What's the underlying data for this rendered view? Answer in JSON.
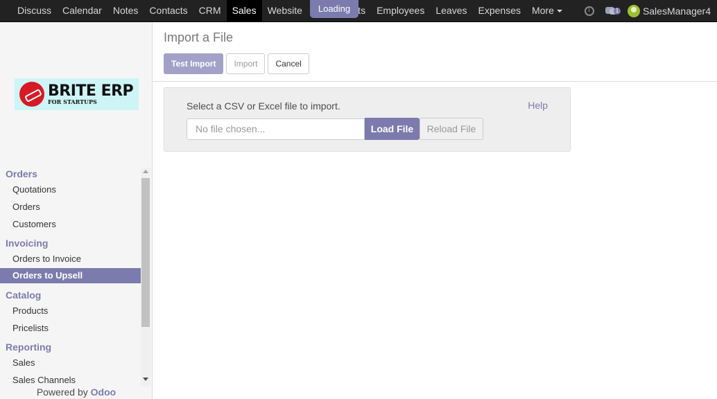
{
  "topnav": {
    "items": [
      "Discuss",
      "Calendar",
      "Notes",
      "Contacts",
      "CRM",
      "Sales",
      "Website",
      "Inv",
      "ents",
      "Employees",
      "Leaves",
      "Expenses",
      "More"
    ],
    "active": "Sales",
    "loading_label": "Loading",
    "chat_count": "1",
    "user_name": "SalesManager4"
  },
  "logo": {
    "title": "BRITE ERP",
    "subtitle": "FOR STARTUPS"
  },
  "sidebar": {
    "sections": [
      {
        "title": "Orders",
        "items": [
          "Quotations",
          "Orders",
          "Customers"
        ]
      },
      {
        "title": "Invoicing",
        "items": [
          "Orders to Invoice",
          "Orders to Upsell"
        ]
      },
      {
        "title": "Catalog",
        "items": [
          "Products",
          "Pricelists"
        ]
      },
      {
        "title": "Reporting",
        "items": [
          "Sales",
          "Sales Channels"
        ]
      }
    ],
    "active_item": "Orders to Upsell",
    "powered_by": "Powered by",
    "powered_brand": "Odoo"
  },
  "main": {
    "title": "Import a File",
    "buttons": {
      "test_import": "Test Import",
      "import": "Import",
      "cancel": "Cancel"
    },
    "import_box": {
      "label": "Select a CSV or Excel file to import.",
      "help": "Help",
      "file_placeholder": "No file chosen...",
      "load_file": "Load File",
      "reload_file": "Reload File"
    }
  },
  "colors": {
    "accent": "#7c7bad",
    "navbar": "#222222"
  }
}
